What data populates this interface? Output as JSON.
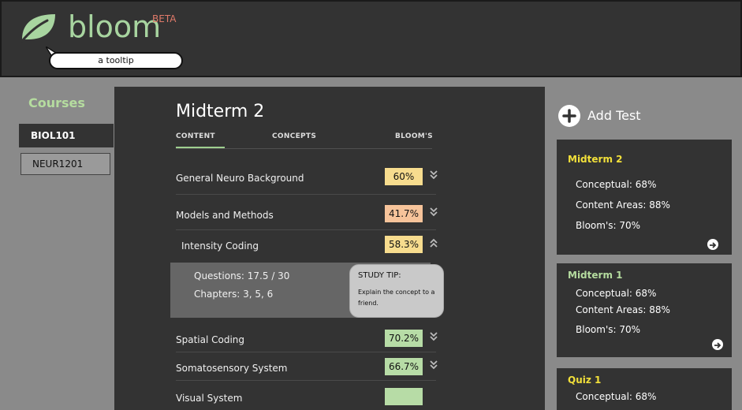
{
  "app": {
    "logo_text": "bloom",
    "beta_label": "BETA",
    "tooltip_text": "a tooltip"
  },
  "colors": {
    "brand_green": "#a8d5a0",
    "beta_red": "#e07a6a",
    "card_title_yellow": "#f2e03a",
    "card_title_green": "#b5dc9f",
    "badge_yellow": "#f7dc8e",
    "badge_orange": "#f6c39a",
    "badge_green": "#b7dca6"
  },
  "sidebar": {
    "title": "Courses",
    "courses": [
      {
        "label": "BIOL101",
        "active": true
      },
      {
        "label": "NEUR1201",
        "active": false
      }
    ]
  },
  "main": {
    "title": "Midterm 2",
    "tabs": [
      {
        "label": "CONTENT",
        "active": true
      },
      {
        "label": "CONCEPTS",
        "active": false
      },
      {
        "label": "BLOOM'S",
        "active": false
      }
    ],
    "rows": [
      {
        "label": "General Neuro Background",
        "score": "60%",
        "color": "yellow",
        "icon": "chevron-double-down-icon"
      },
      {
        "label": "Models and Methods",
        "score": "41.7%",
        "color": "orange",
        "icon": "chevron-double-down-icon"
      },
      {
        "label": "Intensity Coding",
        "score": "58.3%",
        "color": "yellow",
        "icon": "chevron-double-up-icon"
      },
      {
        "label": "Spatial Coding",
        "score": "70.2%",
        "color": "green",
        "icon": "chevron-double-down-icon"
      },
      {
        "label": "Somatosensory System",
        "score": "66.7%",
        "color": "green",
        "icon": "chevron-double-down-icon"
      },
      {
        "label": "Visual System",
        "score": "",
        "color": "green",
        "icon": ""
      }
    ],
    "detail": {
      "questions": "Questions: 17.5 / 30",
      "chapters": "Chapters: 3, 5, 6",
      "tip_title": "STUDY TIP:",
      "tip_body": "Explain the concept to a friend."
    }
  },
  "right": {
    "add_test_label": "Add Test",
    "cards": [
      {
        "title": "Midterm 2",
        "title_color": "yellow",
        "lines": [
          "Conceptual: 68%",
          "Content Areas: 88%",
          "Bloom's: 70%"
        ]
      },
      {
        "title": "Midterm 1",
        "title_color": "green",
        "lines": [
          "Conceptual: 68%",
          "Content Areas: 88%",
          "Bloom's: 70%"
        ]
      },
      {
        "title": "Quiz 1",
        "title_color": "yellow",
        "lines": [
          "Conceptual: 68%"
        ]
      }
    ]
  }
}
